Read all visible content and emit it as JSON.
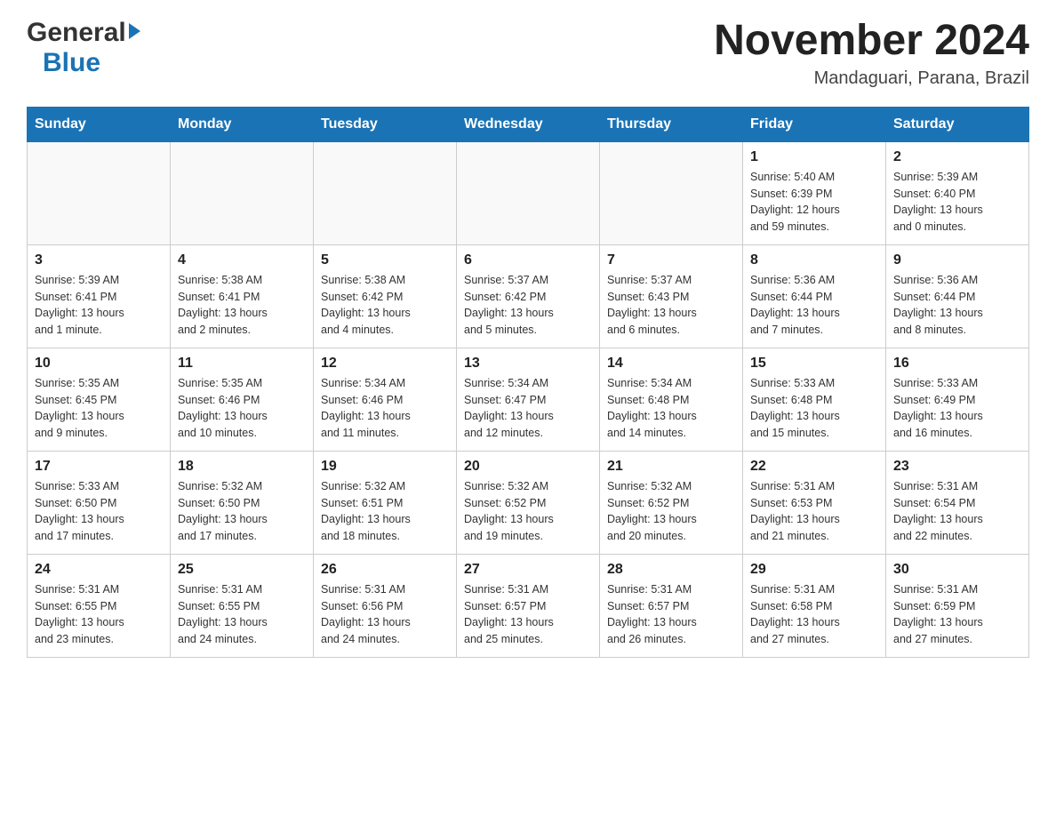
{
  "logo": {
    "general": "General",
    "blue": "Blue"
  },
  "title": "November 2024",
  "location": "Mandaguari, Parana, Brazil",
  "days_of_week": [
    "Sunday",
    "Monday",
    "Tuesday",
    "Wednesday",
    "Thursday",
    "Friday",
    "Saturday"
  ],
  "weeks": [
    [
      {
        "day": "",
        "info": ""
      },
      {
        "day": "",
        "info": ""
      },
      {
        "day": "",
        "info": ""
      },
      {
        "day": "",
        "info": ""
      },
      {
        "day": "",
        "info": ""
      },
      {
        "day": "1",
        "info": "Sunrise: 5:40 AM\nSunset: 6:39 PM\nDaylight: 12 hours\nand 59 minutes."
      },
      {
        "day": "2",
        "info": "Sunrise: 5:39 AM\nSunset: 6:40 PM\nDaylight: 13 hours\nand 0 minutes."
      }
    ],
    [
      {
        "day": "3",
        "info": "Sunrise: 5:39 AM\nSunset: 6:41 PM\nDaylight: 13 hours\nand 1 minute."
      },
      {
        "day": "4",
        "info": "Sunrise: 5:38 AM\nSunset: 6:41 PM\nDaylight: 13 hours\nand 2 minutes."
      },
      {
        "day": "5",
        "info": "Sunrise: 5:38 AM\nSunset: 6:42 PM\nDaylight: 13 hours\nand 4 minutes."
      },
      {
        "day": "6",
        "info": "Sunrise: 5:37 AM\nSunset: 6:42 PM\nDaylight: 13 hours\nand 5 minutes."
      },
      {
        "day": "7",
        "info": "Sunrise: 5:37 AM\nSunset: 6:43 PM\nDaylight: 13 hours\nand 6 minutes."
      },
      {
        "day": "8",
        "info": "Sunrise: 5:36 AM\nSunset: 6:44 PM\nDaylight: 13 hours\nand 7 minutes."
      },
      {
        "day": "9",
        "info": "Sunrise: 5:36 AM\nSunset: 6:44 PM\nDaylight: 13 hours\nand 8 minutes."
      }
    ],
    [
      {
        "day": "10",
        "info": "Sunrise: 5:35 AM\nSunset: 6:45 PM\nDaylight: 13 hours\nand 9 minutes."
      },
      {
        "day": "11",
        "info": "Sunrise: 5:35 AM\nSunset: 6:46 PM\nDaylight: 13 hours\nand 10 minutes."
      },
      {
        "day": "12",
        "info": "Sunrise: 5:34 AM\nSunset: 6:46 PM\nDaylight: 13 hours\nand 11 minutes."
      },
      {
        "day": "13",
        "info": "Sunrise: 5:34 AM\nSunset: 6:47 PM\nDaylight: 13 hours\nand 12 minutes."
      },
      {
        "day": "14",
        "info": "Sunrise: 5:34 AM\nSunset: 6:48 PM\nDaylight: 13 hours\nand 14 minutes."
      },
      {
        "day": "15",
        "info": "Sunrise: 5:33 AM\nSunset: 6:48 PM\nDaylight: 13 hours\nand 15 minutes."
      },
      {
        "day": "16",
        "info": "Sunrise: 5:33 AM\nSunset: 6:49 PM\nDaylight: 13 hours\nand 16 minutes."
      }
    ],
    [
      {
        "day": "17",
        "info": "Sunrise: 5:33 AM\nSunset: 6:50 PM\nDaylight: 13 hours\nand 17 minutes."
      },
      {
        "day": "18",
        "info": "Sunrise: 5:32 AM\nSunset: 6:50 PM\nDaylight: 13 hours\nand 17 minutes."
      },
      {
        "day": "19",
        "info": "Sunrise: 5:32 AM\nSunset: 6:51 PM\nDaylight: 13 hours\nand 18 minutes."
      },
      {
        "day": "20",
        "info": "Sunrise: 5:32 AM\nSunset: 6:52 PM\nDaylight: 13 hours\nand 19 minutes."
      },
      {
        "day": "21",
        "info": "Sunrise: 5:32 AM\nSunset: 6:52 PM\nDaylight: 13 hours\nand 20 minutes."
      },
      {
        "day": "22",
        "info": "Sunrise: 5:31 AM\nSunset: 6:53 PM\nDaylight: 13 hours\nand 21 minutes."
      },
      {
        "day": "23",
        "info": "Sunrise: 5:31 AM\nSunset: 6:54 PM\nDaylight: 13 hours\nand 22 minutes."
      }
    ],
    [
      {
        "day": "24",
        "info": "Sunrise: 5:31 AM\nSunset: 6:55 PM\nDaylight: 13 hours\nand 23 minutes."
      },
      {
        "day": "25",
        "info": "Sunrise: 5:31 AM\nSunset: 6:55 PM\nDaylight: 13 hours\nand 24 minutes."
      },
      {
        "day": "26",
        "info": "Sunrise: 5:31 AM\nSunset: 6:56 PM\nDaylight: 13 hours\nand 24 minutes."
      },
      {
        "day": "27",
        "info": "Sunrise: 5:31 AM\nSunset: 6:57 PM\nDaylight: 13 hours\nand 25 minutes."
      },
      {
        "day": "28",
        "info": "Sunrise: 5:31 AM\nSunset: 6:57 PM\nDaylight: 13 hours\nand 26 minutes."
      },
      {
        "day": "29",
        "info": "Sunrise: 5:31 AM\nSunset: 6:58 PM\nDaylight: 13 hours\nand 27 minutes."
      },
      {
        "day": "30",
        "info": "Sunrise: 5:31 AM\nSunset: 6:59 PM\nDaylight: 13 hours\nand 27 minutes."
      }
    ]
  ]
}
